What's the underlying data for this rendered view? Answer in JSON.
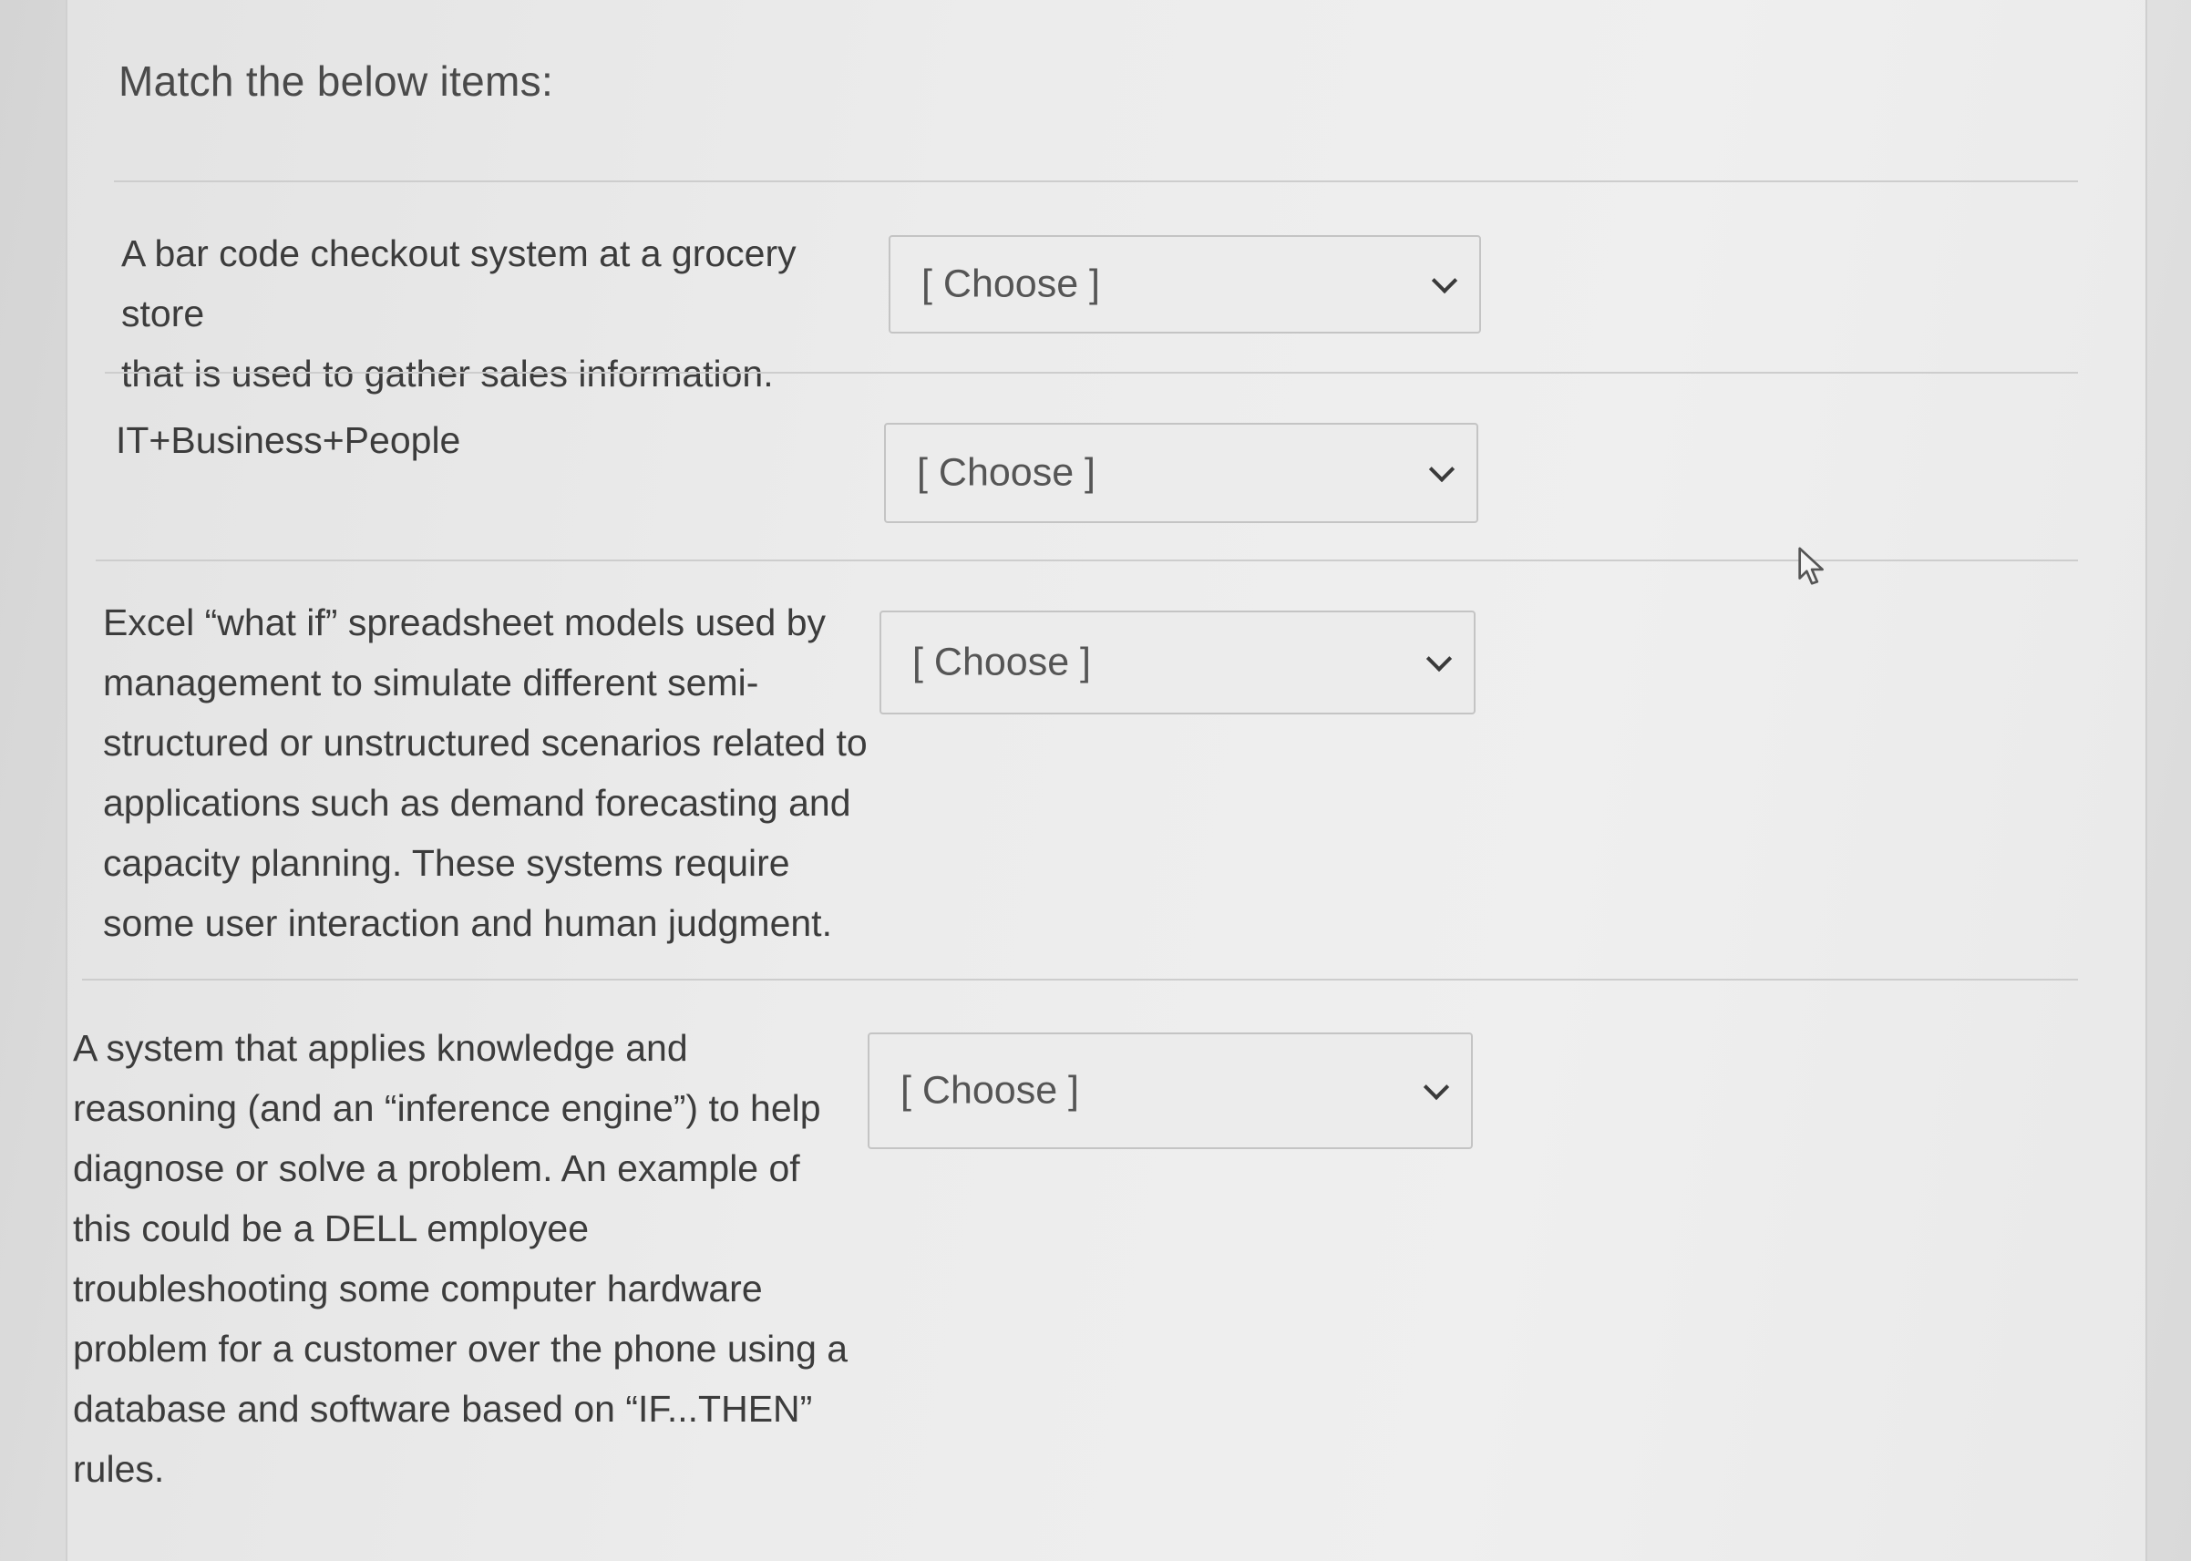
{
  "question": {
    "title": "Match the below items:"
  },
  "items": [
    {
      "prompt": "A bar code checkout system at a grocery store\nthat is used to gather sales information.",
      "select_value": "[ Choose ]"
    },
    {
      "prompt": "IT+Business+People",
      "select_value": "[ Choose ]"
    },
    {
      "prompt": "Excel “what if” spreadsheet models used by\nmanagement to simulate different semi-\nstructured or unstructured scenarios related to\napplications such as demand forecasting and\ncapacity planning.  These systems require\nsome user interaction and human judgment.",
      "select_value": "[ Choose ]"
    },
    {
      "prompt": "A system that applies knowledge and\nreasoning (and an “inference engine”) to help\ndiagnose or solve a problem.  An example of\nthis could be a DELL employee\ntroubleshooting some computer hardware\nproblem for a customer over the phone using a\ndatabase and software based on “IF...THEN”\nrules.",
      "select_value": "[ Choose ]"
    }
  ],
  "icons": {
    "dropdown": "chevron-down-icon",
    "cursor": "mouse-pointer-icon"
  }
}
